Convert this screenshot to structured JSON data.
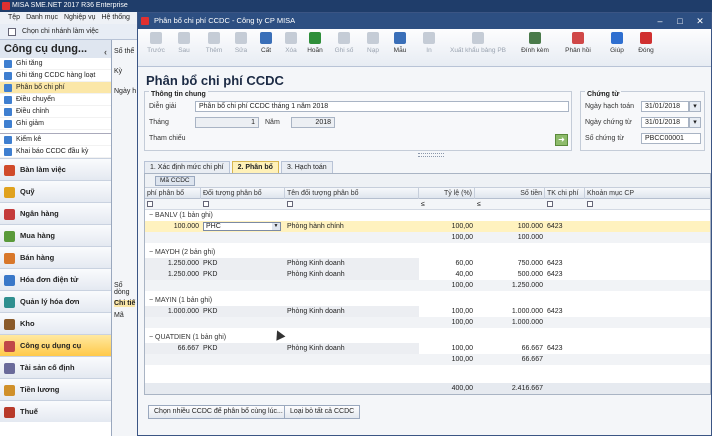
{
  "main_window": {
    "title": "MISA SME.NET 2017 R36 Enterprise",
    "menu": [
      "Tệp",
      "Danh mục",
      "Nghiệp vụ",
      "Hệ thống"
    ],
    "branch_button": "Chọn chi nhánh làm việc",
    "tim_label": "Tìm"
  },
  "sidebar": {
    "title": "Công cụ dụng...",
    "sub_items": [
      "Ghi tăng",
      "Ghi tăng CCDC hàng loạt",
      "Phân bổ chi phí",
      "Điều chuyển",
      "Điều chỉnh",
      "Ghi giảm",
      "Kiểm kê",
      "Khai báo CCDC đầu kỳ"
    ],
    "active_sub_index": 2,
    "modules": [
      {
        "label": "Bàn làm việc",
        "color": "#d04a2a"
      },
      {
        "label": "Quỹ",
        "color": "#e0a21e"
      },
      {
        "label": "Ngân hàng",
        "color": "#c43b3b"
      },
      {
        "label": "Mua hàng",
        "color": "#5a9a3a"
      },
      {
        "label": "Bán hàng",
        "color": "#d8772a"
      },
      {
        "label": "Hóa đơn điện tử",
        "color": "#3a78c8"
      },
      {
        "label": "Quản lý hóa đơn",
        "color": "#2f8f8f"
      },
      {
        "label": "Kho",
        "color": "#8a5a2a"
      },
      {
        "label": "Công cụ dụng cụ",
        "color": "#c04848"
      },
      {
        "label": "Tài sản cố định",
        "color": "#6a6a9a"
      },
      {
        "label": "Tiền lương",
        "color": "#d0902a"
      },
      {
        "label": "Thuế",
        "color": "#b83a2a"
      }
    ],
    "active_module_index": 8
  },
  "back_panel": {
    "so_label": "Số thể",
    "ky_label": "Kỳ",
    "ngay_label": "Ngày h",
    "so_dong_label": "Số dòng",
    "chi_tiet_label": "Chi tiế",
    "ma_label": "Mã"
  },
  "dialog": {
    "title": "Phân bổ chi phí CCDC - Công ty CP MISA",
    "toolbar": [
      {
        "label": "Trước",
        "disabled": true,
        "color": "#888"
      },
      {
        "label": "Sau",
        "disabled": true,
        "color": "#888"
      },
      {
        "label": "Thêm",
        "disabled": true,
        "color": "#888"
      },
      {
        "label": "Sửa",
        "disabled": true,
        "color": "#888"
      },
      {
        "label": "Cất",
        "disabled": false,
        "color": "#3a6fb8"
      },
      {
        "label": "Xóa",
        "disabled": true,
        "color": "#888"
      },
      {
        "label": "Hoãn",
        "disabled": false,
        "color": "#2f8f3a"
      },
      {
        "label": "Ghi số",
        "disabled": true,
        "color": "#888"
      },
      {
        "label": "Nạp",
        "disabled": true,
        "color": "#888"
      },
      {
        "label": "Mẫu",
        "disabled": false,
        "color": "#3a6fb8"
      },
      {
        "label": "In",
        "disabled": true,
        "color": "#888"
      },
      {
        "label": "Xuất khẩu bảng PB",
        "disabled": true,
        "color": "#888"
      },
      {
        "label": "Đính kèm",
        "disabled": false,
        "color": "#4a7a4a"
      },
      {
        "label": "Phản hồi",
        "disabled": false,
        "color": "#d04848"
      },
      {
        "label": "Giúp",
        "disabled": false,
        "color": "#2f6fd0"
      },
      {
        "label": "Đóng",
        "disabled": false,
        "color": "#d03030"
      }
    ],
    "page_title": "Phân bổ chi phí CCDC",
    "general": {
      "title": "Thông tin chung",
      "dien_giai_label": "Diễn giải",
      "dien_giai_value": "Phân bổ chi phí CCDC tháng 1 năm 2018",
      "thang_label": "Tháng",
      "thang_value": "1",
      "nam_label": "Năm",
      "nam_value": "2018",
      "tham_chieu_label": "Tham chiếu"
    },
    "voucher": {
      "title": "Chứng từ",
      "ngay_hach_toan_label": "Ngày hạch toán",
      "ngay_hach_toan_value": "31/01/2018",
      "ngay_chung_tu_label": "Ngày chứng từ",
      "ngay_chung_tu_value": "31/01/2018",
      "so_chung_tu_label": "Số chứng từ",
      "so_chung_tu_value": "PBCC00001"
    },
    "tabs": [
      "1. Xác định mức chi phí",
      "2. Phân bổ",
      "3. Hạch toán"
    ],
    "active_tab": 1,
    "group_chip": "Mã CCDC",
    "columns": [
      "phí phân bổ",
      "Đối tượng phân bổ",
      "Tên đối tượng phân bổ",
      "Tỷ lệ (%)",
      "Số tiền",
      "TK chi phí",
      "Khoản mục CP"
    ],
    "filter_symbols": {
      "le": "≤",
      "box": ""
    },
    "groups": [
      {
        "header": "BANLV (1 bản ghi)",
        "rows": [
          {
            "chi_phi": "100.000",
            "doi_tuong": "PHC",
            "ten": "Phòng hành chính",
            "ty_le": "100,00",
            "so_tien": "100.000",
            "tk": "6423",
            "selected": true
          }
        ],
        "sub_ty_le": "100,00",
        "sub_so_tien": "100.000"
      },
      {
        "header": "MAYDH (2 bản ghi)",
        "rows": [
          {
            "chi_phi": "1.250.000",
            "doi_tuong": "PKD",
            "ten": "Phòng Kinh doanh",
            "ty_le": "60,00",
            "so_tien": "750.000",
            "tk": "6423",
            "selected": false
          },
          {
            "chi_phi": "1.250.000",
            "doi_tuong": "PKD",
            "ten": "Phòng Kinh doanh",
            "ty_le": "40,00",
            "so_tien": "500.000",
            "tk": "6423",
            "selected": false
          }
        ],
        "sub_ty_le": "100,00",
        "sub_so_tien": "1.250.000"
      },
      {
        "header": "MAYIN (1 bản ghi)",
        "rows": [
          {
            "chi_phi": "1.000.000",
            "doi_tuong": "PKD",
            "ten": "Phòng Kinh doanh",
            "ty_le": "100,00",
            "so_tien": "1.000.000",
            "tk": "6423",
            "selected": false
          }
        ],
        "sub_ty_le": "100,00",
        "sub_so_tien": "1.000.000"
      },
      {
        "header": "QUATDIEN (1 bản ghi)",
        "rows": [
          {
            "chi_phi": "66.667",
            "doi_tuong": "PKD",
            "ten": "Phòng Kinh doanh",
            "ty_le": "100,00",
            "so_tien": "66.667",
            "tk": "6423",
            "selected": false
          }
        ],
        "sub_ty_le": "100,00",
        "sub_so_tien": "66.667"
      }
    ],
    "grand_ty_le": "400,00",
    "grand_so_tien": "2.416.667",
    "buttons": {
      "multi_select": "Chọn nhiều CCDC để phân bổ cùng lúc...",
      "remove_all": "Loại bỏ tất cả CCDC"
    }
  }
}
